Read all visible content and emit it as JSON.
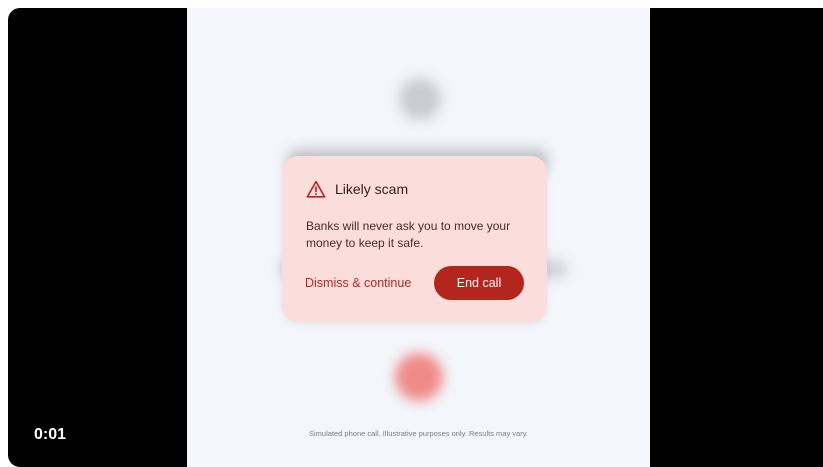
{
  "video": {
    "timestamp": "0:01",
    "disclaimer": "Simulated phone call. Illustrative purposes only. Results may vary."
  },
  "scam_alert": {
    "icon": "warning-triangle-icon",
    "title": "Likely scam",
    "message": "Banks will never ask you to move your money to keep it safe.",
    "dismiss_label": "Dismiss & continue",
    "end_call_label": "End call"
  },
  "colors": {
    "card_background": "#fbdedb",
    "accent": "#b3261e",
    "video_background": "#000000"
  }
}
